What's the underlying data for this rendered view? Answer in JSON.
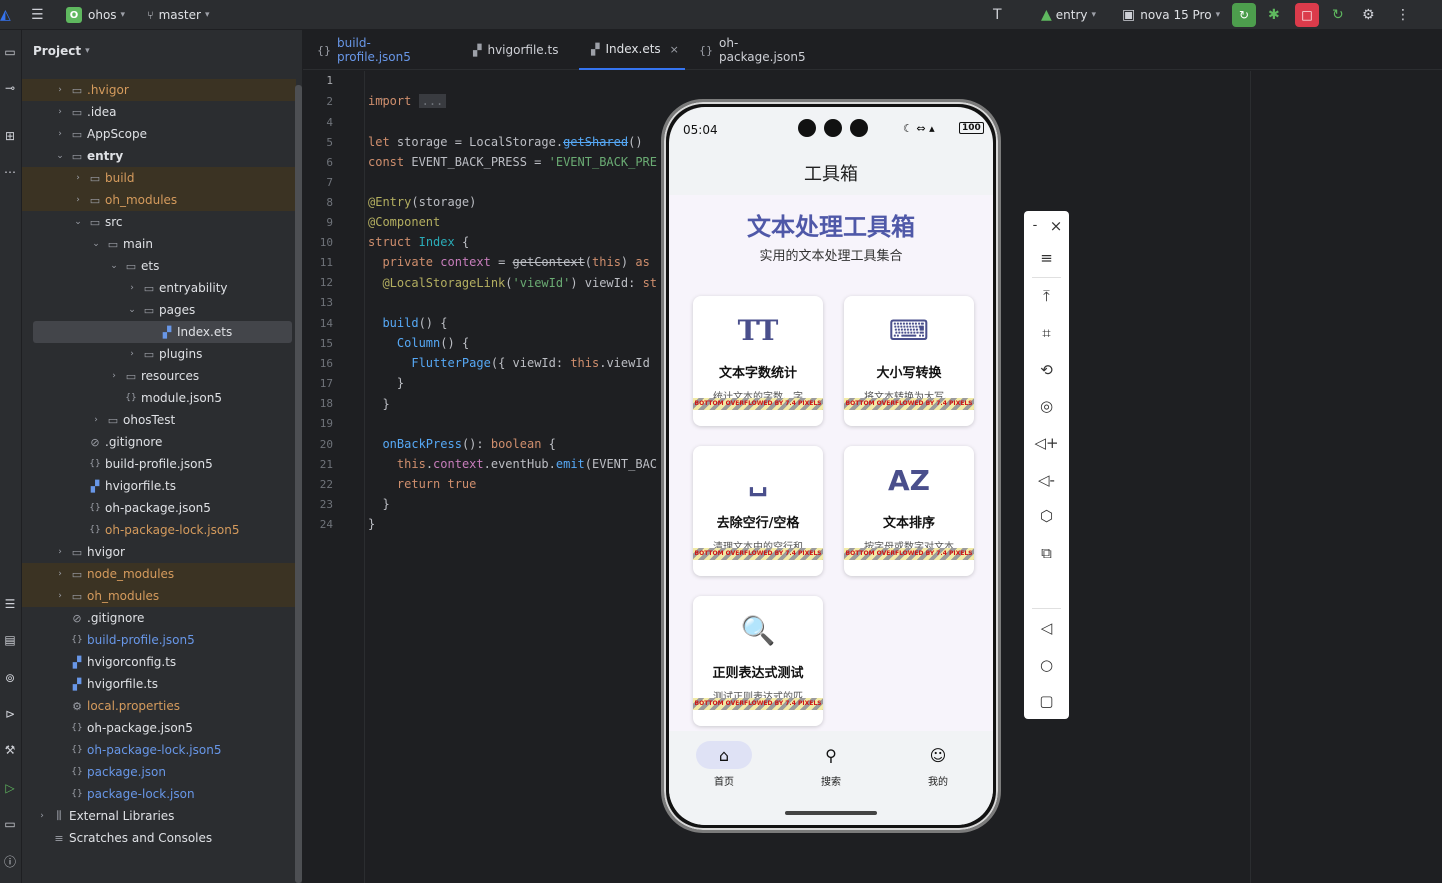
{
  "toolbar": {
    "project_badge": "O",
    "project_name": "ohos",
    "branch": "master",
    "module": "entry",
    "device": "nova 15 Pro"
  },
  "project_panel": {
    "title": "Project",
    "items": [
      {
        "label": ".hvigor",
        "depth": 1,
        "type": "folder",
        "expanded": false,
        "style": "orange",
        "excluded": true
      },
      {
        "label": ".idea",
        "depth": 1,
        "type": "folder",
        "expanded": false,
        "style": "normal",
        "excluded": false
      },
      {
        "label": "AppScope",
        "depth": 1,
        "type": "folder",
        "expanded": false,
        "style": "normal",
        "excluded": false
      },
      {
        "label": "entry",
        "depth": 1,
        "type": "module",
        "expanded": true,
        "style": "bold",
        "excluded": false
      },
      {
        "label": "build",
        "depth": 2,
        "type": "folder",
        "expanded": false,
        "style": "orange",
        "excluded": true
      },
      {
        "label": "oh_modules",
        "depth": 2,
        "type": "folder",
        "expanded": false,
        "style": "orange",
        "excluded": true
      },
      {
        "label": "src",
        "depth": 2,
        "type": "folder",
        "expanded": true,
        "style": "normal",
        "excluded": false
      },
      {
        "label": "main",
        "depth": 3,
        "type": "folder",
        "expanded": true,
        "style": "normal",
        "excluded": false
      },
      {
        "label": "ets",
        "depth": 4,
        "type": "folder",
        "expanded": true,
        "style": "normal",
        "excluded": false
      },
      {
        "label": "entryability",
        "depth": 5,
        "type": "folder",
        "expanded": false,
        "style": "normal",
        "excluded": false
      },
      {
        "label": "pages",
        "depth": 5,
        "type": "folder",
        "expanded": true,
        "style": "normal",
        "excluded": false
      },
      {
        "label": "Index.ets",
        "depth": 6,
        "type": "ets",
        "style": "normal",
        "selected": true
      },
      {
        "label": "plugins",
        "depth": 5,
        "type": "folder",
        "expanded": false,
        "style": "normal",
        "excluded": false
      },
      {
        "label": "resources",
        "depth": 4,
        "type": "folder",
        "expanded": false,
        "style": "normal",
        "excluded": false
      },
      {
        "label": "module.json5",
        "depth": 4,
        "type": "json",
        "style": "normal"
      },
      {
        "label": "ohosTest",
        "depth": 3,
        "type": "folder",
        "expanded": false,
        "style": "normal",
        "excluded": false
      },
      {
        "label": ".gitignore",
        "depth": 2,
        "type": "ignore",
        "style": "normal"
      },
      {
        "label": "build-profile.json5",
        "depth": 2,
        "type": "json",
        "style": "normal"
      },
      {
        "label": "hvigorfile.ts",
        "depth": 2,
        "type": "hvigor",
        "style": "normal"
      },
      {
        "label": "oh-package.json5",
        "depth": 2,
        "type": "json",
        "style": "normal"
      },
      {
        "label": "oh-package-lock.json5",
        "depth": 2,
        "type": "json",
        "style": "orange"
      },
      {
        "label": "hvigor",
        "depth": 1,
        "type": "folder",
        "expanded": false,
        "style": "normal",
        "excluded": false
      },
      {
        "label": "node_modules",
        "depth": 1,
        "type": "folder",
        "expanded": false,
        "style": "orange",
        "excluded": true
      },
      {
        "label": "oh_modules",
        "depth": 1,
        "type": "folder",
        "expanded": false,
        "style": "orange",
        "excluded": true
      },
      {
        "label": ".gitignore",
        "depth": 1,
        "type": "ignore",
        "style": "normal"
      },
      {
        "label": "build-profile.json5",
        "depth": 1,
        "type": "json",
        "style": "blue"
      },
      {
        "label": "hvigorconfig.ts",
        "depth": 1,
        "type": "hvigor",
        "style": "normal"
      },
      {
        "label": "hvigorfile.ts",
        "depth": 1,
        "type": "hvigor",
        "style": "normal"
      },
      {
        "label": "local.properties",
        "depth": 1,
        "type": "settings",
        "style": "orange"
      },
      {
        "label": "oh-package.json5",
        "depth": 1,
        "type": "json",
        "style": "normal"
      },
      {
        "label": "oh-package-lock.json5",
        "depth": 1,
        "type": "json",
        "style": "blue"
      },
      {
        "label": "package.json",
        "depth": 1,
        "type": "json",
        "style": "blue"
      },
      {
        "label": "package-lock.json",
        "depth": 1,
        "type": "json",
        "style": "blue"
      },
      {
        "label": "External Libraries",
        "depth": 0,
        "type": "library",
        "expanded": false,
        "style": "normal"
      },
      {
        "label": "Scratches and Consoles",
        "depth": 0,
        "type": "scratch",
        "style": "normal"
      }
    ]
  },
  "editor": {
    "tabs": [
      {
        "label": "build-profile.json5",
        "active": false,
        "style": "blue"
      },
      {
        "label": "hvigorfile.ts",
        "active": false,
        "style": "normal"
      },
      {
        "label": "Index.ets",
        "active": true,
        "style": "normal"
      },
      {
        "label": "oh-package.json5",
        "active": false,
        "style": "normal"
      }
    ],
    "line_numbers": [
      "1",
      "2",
      "4",
      "5",
      "6",
      "7",
      "8",
      "9",
      "10",
      "11",
      "12",
      "13",
      "14",
      "15",
      "16",
      "17",
      "18",
      "19",
      "20",
      "21",
      "22",
      "23",
      "24"
    ]
  },
  "phone": {
    "time": "05:04",
    "battery": "100",
    "appbar_title": "工具箱",
    "hero_title": "文本处理工具箱",
    "hero_subtitle": "实用的文本处理工具集合",
    "cards": [
      {
        "icon": "text-fields-icon",
        "glyph": "TT",
        "title": "文本字数统计",
        "desc": "统计文本的字数、字"
      },
      {
        "icon": "keyboard-icon",
        "glyph": "⌨",
        "title": "大小写转换",
        "desc": "将文本转换为大写、"
      },
      {
        "icon": "space-bar-icon",
        "glyph": "␣",
        "title": "去除空行/空格",
        "desc": "清理文本中的空行和"
      },
      {
        "icon": "sort-az-icon",
        "glyph": "AZ",
        "title": "文本排序",
        "desc": "按字母或数字对文本"
      },
      {
        "icon": "regex-search-icon",
        "glyph": "🔍",
        "title": "正则表达式测试",
        "desc": "测试正则表达式的匹"
      }
    ],
    "overflow_text": "BOTTOM OVERFLOWED BY 7.4 PIXELS",
    "nav": [
      {
        "label": "首页",
        "icon": "home-icon",
        "glyph": "⌂",
        "active": true
      },
      {
        "label": "搜索",
        "icon": "search-icon",
        "glyph": "⚲",
        "active": false
      },
      {
        "label": "我的",
        "icon": "person-icon",
        "glyph": "☺",
        "active": false
      }
    ]
  },
  "emulator_controls": {
    "minimize": "-",
    "close": "×"
  }
}
